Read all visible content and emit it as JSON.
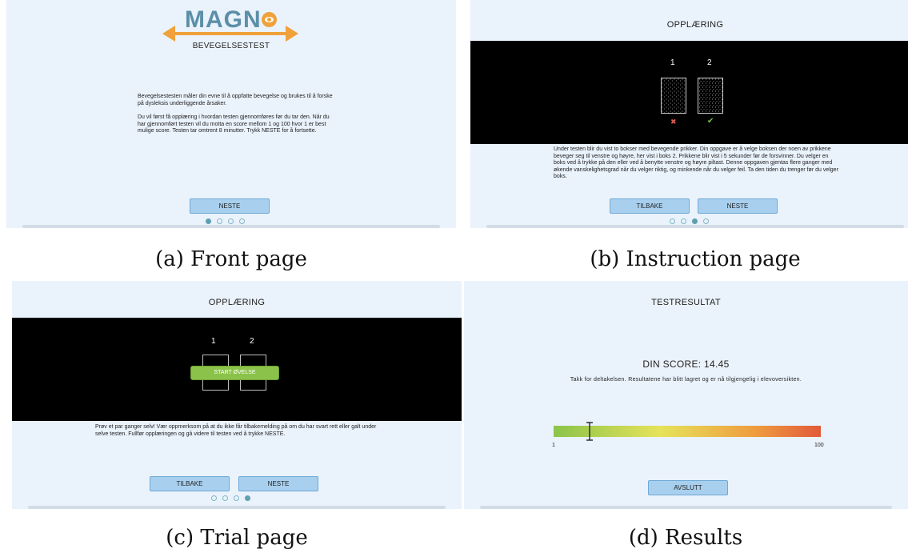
{
  "panel_a": {
    "logo_text": "MAGN",
    "subtitle": "BEVEGELSESTEST",
    "paragraph1": "Bevegelsestesten måler din evne til å oppfatte bevegelse og brukes til å forske på dysleksis underliggende årsaker.",
    "paragraph2": "Du vil først få opplæring i hvordan testen gjennomføres før du tar den. Når du har gjennomført testen vil du motta en score mellom 1 og 100 hvor 1 er best mulige score. Testen tar omtrent 8 minutter. Trykk NESTE for å fortsette.",
    "next_button": "NESTE",
    "caption": "(a) Front page",
    "dots_active": 0
  },
  "panel_b": {
    "title": "OPPLÆRING",
    "box1_label": "1",
    "box2_label": "2",
    "wrong_mark": "✖",
    "right_mark": "✔",
    "instructions": "Under testen blir du vist to bokser med bevegende prikker. Din oppgave er å velge boksen der noen av prikkene beveger seg til venstre og høyre, her vist i boks 2. Prikkene blir vist i 5 sekunder før de forsvinner. Du velger en boks ved å trykke på den eller ved å benytte venstre og høyre piltast. Denne oppgaven gjentas flere ganger med økende vanskelighetsgrad når du velger riktig, og minkende når du velger feil. Ta den tiden du trenger før du velger boks.",
    "back_button": "TILBAKE",
    "next_button": "NESTE",
    "caption": "(b) Instruction page",
    "dots_active": 2
  },
  "panel_c": {
    "title": "OPPLÆRING",
    "box1_label": "1",
    "box2_label": "2",
    "start_button": "START ØVELSE",
    "instructions": "Prøv et par ganger selv! Vær oppmerksom på at du ikke får tilbakemelding på om du har svart rett eller galt under selve testen. Fullfør opplæringen og gå videre til testen ved å trykke NESTE.",
    "back_button": "TILBAKE",
    "next_button": "NESTE",
    "caption": "(c) Trial page",
    "dots_active": 3
  },
  "panel_d": {
    "title": "TESTRESULTAT",
    "score_text": "DIN SCORE: 14.45",
    "score_value": 14.45,
    "thanks": "Takk for deltakelsen. Resultatene har blitt lagret og er nå tilgjengelig i elevoversikten.",
    "scale_min": "1",
    "scale_max": "100",
    "finish_button": "AVSLUTT",
    "caption": "(d) Results"
  },
  "colors": {
    "panel_bg": "#eaf2fb",
    "button_bg": "#a8d0ee",
    "logo_blue": "#5b8fa8",
    "logo_orange": "#f0a13a",
    "green": "#8bc34a",
    "wrong_red": "#e05a4f",
    "right_green": "#7cc243"
  }
}
